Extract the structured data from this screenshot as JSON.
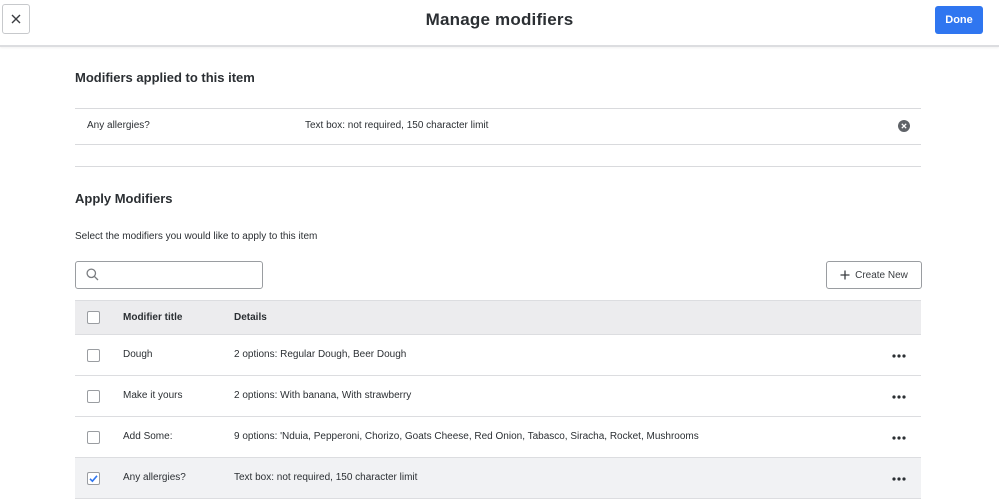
{
  "header": {
    "title": "Manage modifiers",
    "done_label": "Done"
  },
  "applied_section": {
    "title": "Modifiers applied to this item",
    "items": [
      {
        "name": "Any allergies?",
        "details": "Text box: not required, 150 character limit"
      }
    ]
  },
  "apply_section": {
    "title": "Apply Modifiers",
    "subtitle": "Select the modifiers you would like to apply to this item",
    "search": {
      "value": "",
      "placeholder": ""
    },
    "create_label": "Create New",
    "table": {
      "columns": [
        "Modifier title",
        "Details"
      ],
      "rows": [
        {
          "title": "Dough",
          "details": "2 options: Regular Dough, Beer Dough",
          "checked": false
        },
        {
          "title": "Make it yours",
          "details": "2 options: With banana, With strawberry",
          "checked": false
        },
        {
          "title": "Add Some:",
          "details": "9 options: 'Nduia, Pepperoni, Chorizo, Goats Cheese, Red Onion, Tabasco, Siracha, Rocket, Mushrooms",
          "checked": false
        },
        {
          "title": "Any allergies?",
          "details": "Text box: not required, 150 character limit",
          "checked": true
        }
      ]
    }
  },
  "colors": {
    "primary": "#2f76f0",
    "text": "#2b2f33",
    "header_bg": "#ececee",
    "border": "#d9dadd"
  },
  "icons": {
    "close": "close-icon",
    "remove": "remove-circle-icon",
    "search": "search-icon",
    "plus": "plus-icon",
    "more": "more-horizontal-icon",
    "check": "check-icon"
  }
}
